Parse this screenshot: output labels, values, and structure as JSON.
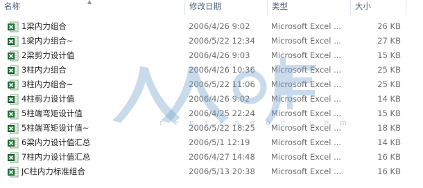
{
  "columns": {
    "name": "名称",
    "date": "修改日期",
    "type": "类型",
    "size": "大小"
  },
  "files": [
    {
      "name": "1梁内力组合",
      "date": "2006/4/26 9:02",
      "type": "Microsoft Excel ...",
      "size": "26 KB"
    },
    {
      "name": "1梁内力组合~",
      "date": "2006/5/22 12:34",
      "type": "Microsoft Excel ...",
      "size": "27 KB"
    },
    {
      "name": "2梁剪力设计值",
      "date": "2006/4/26 9:03",
      "type": "Microsoft Excel ...",
      "size": "15 KB"
    },
    {
      "name": "3柱内力组合",
      "date": "2006/4/26 10:36",
      "type": "Microsoft Excel ...",
      "size": "25 KB"
    },
    {
      "name": "3柱内力组合~",
      "date": "2006/5/22 11:06",
      "type": "Microsoft Excel ...",
      "size": "25 KB"
    },
    {
      "name": "4柱剪力设计值",
      "date": "2006/4/26 9:02",
      "type": "Microsoft Excel ...",
      "size": "14 KB"
    },
    {
      "name": "5柱端弯矩设计值",
      "date": "2006/4/25 22:24",
      "type": "Microsoft Excel ...",
      "size": "15 KB"
    },
    {
      "name": "5柱端弯矩设计值~",
      "date": "2006/5/22 18:25",
      "type": "Microsoft Excel ...",
      "size": "18 KB"
    },
    {
      "name": "6梁内力设计值汇总",
      "date": "2006/5/1 12:19",
      "type": "Microsoft Excel ...",
      "size": "14 KB"
    },
    {
      "name": "7柱内力设计值汇总",
      "date": "2006/4/27 14:48",
      "type": "Microsoft Excel ...",
      "size": "16 KB"
    },
    {
      "name": "JC柱内力标准组合",
      "date": "2006/5/13 20:38",
      "type": "Microsoft Excel ...",
      "size": "16 KB"
    }
  ],
  "icon": "excel-file-icon",
  "watermark": {
    "text": "人人文库",
    "domain": "r e n r e n d o c . c o m"
  },
  "colors": {
    "header_text": "#4c607a",
    "name_text": "#1e1e1e",
    "meta_text": "#6d6d6d",
    "excel_green": "#1f7a3a"
  }
}
